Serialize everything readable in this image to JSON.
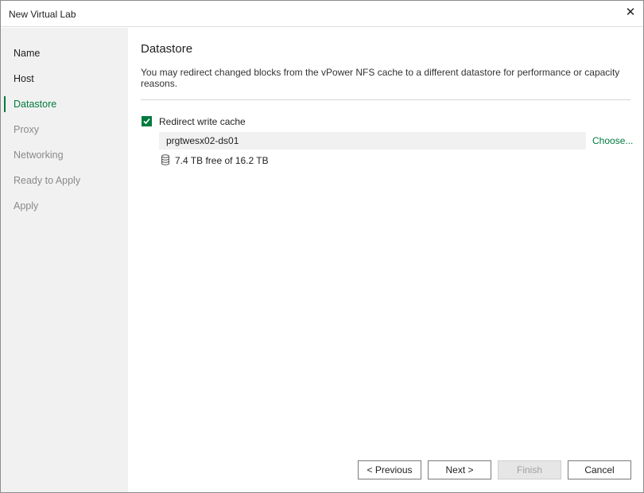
{
  "window": {
    "title": "New Virtual Lab",
    "close_glyph": "✕"
  },
  "sidebar": {
    "items": [
      {
        "label": "Name",
        "state": "done"
      },
      {
        "label": "Host",
        "state": "done"
      },
      {
        "label": "Datastore",
        "state": "active"
      },
      {
        "label": "Proxy",
        "state": "pending"
      },
      {
        "label": "Networking",
        "state": "pending"
      },
      {
        "label": "Ready to Apply",
        "state": "pending"
      },
      {
        "label": "Apply",
        "state": "pending"
      }
    ]
  },
  "main": {
    "heading": "Datastore",
    "description": "You may redirect changed blocks from the vPower NFS cache to a different datastore for performance or capacity reasons.",
    "redirect_checkbox": {
      "label": "Redirect write cache",
      "checked": true
    },
    "datastore": {
      "value": "prgtwesx02-ds01",
      "choose_label": "Choose...",
      "free_space": "7.4 TB free of 16.2 TB",
      "icon": "database-icon"
    }
  },
  "buttons": {
    "previous": "< Previous",
    "next": "Next >",
    "finish": "Finish",
    "cancel": "Cancel"
  },
  "colors": {
    "accent": "#007a3d",
    "sidebar_bg": "#f1f1f1",
    "pending_text": "#8a8a8a"
  }
}
